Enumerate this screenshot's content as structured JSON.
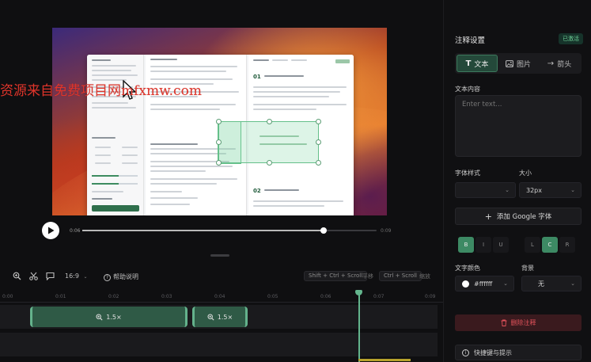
{
  "watermark": {
    "text": "资源来自免费项目网mfxmw.com"
  },
  "player": {
    "current_time": "0:06",
    "duration": "0:09",
    "progress": 0.82
  },
  "toolbar": {
    "aspect_ratio": "16:9",
    "help_label": "帮助说明",
    "shortcut1": "Shift + Ctrl + Scroll",
    "shortcut1_label": "平移",
    "shortcut2": "Ctrl + Scroll",
    "shortcut2_label": "缩放"
  },
  "timeline": {
    "ticks": [
      "0:00",
      "0:01",
      "0:02",
      "0:03",
      "0:04",
      "0:05",
      "0:06",
      "0:07",
      "0:09"
    ],
    "clips": [
      {
        "label": "1.5×",
        "icon": "zoom-in-icon"
      },
      {
        "label": "1.5×",
        "icon": "zoom-in-icon"
      }
    ]
  },
  "panel": {
    "title": "注释设置",
    "badge": "已激活",
    "tabs": [
      {
        "label": "文本",
        "icon": "text-icon",
        "active": true
      },
      {
        "label": "图片",
        "icon": "image-icon",
        "active": false
      },
      {
        "label": "箭头",
        "icon": "arrow-icon",
        "active": false
      }
    ],
    "content_label": "文本内容",
    "content_placeholder": "Enter text...",
    "font_style_label": "字体样式",
    "font_style_value": "",
    "size_label": "大小",
    "size_value": "32px",
    "add_font_label": "添加 Google 字体",
    "format_buttons": [
      "B",
      "I",
      "U",
      "L",
      "C",
      "R"
    ],
    "text_color_label": "文字颜色",
    "text_color_value": "#ffffff",
    "background_label": "背景",
    "background_value": "无",
    "delete_label": "删除注释",
    "shortcuts_label": "快捷键与提示"
  },
  "colors": {
    "accent": "#3d8a64",
    "danger": "#e2525b",
    "background": "#0f0f11"
  }
}
